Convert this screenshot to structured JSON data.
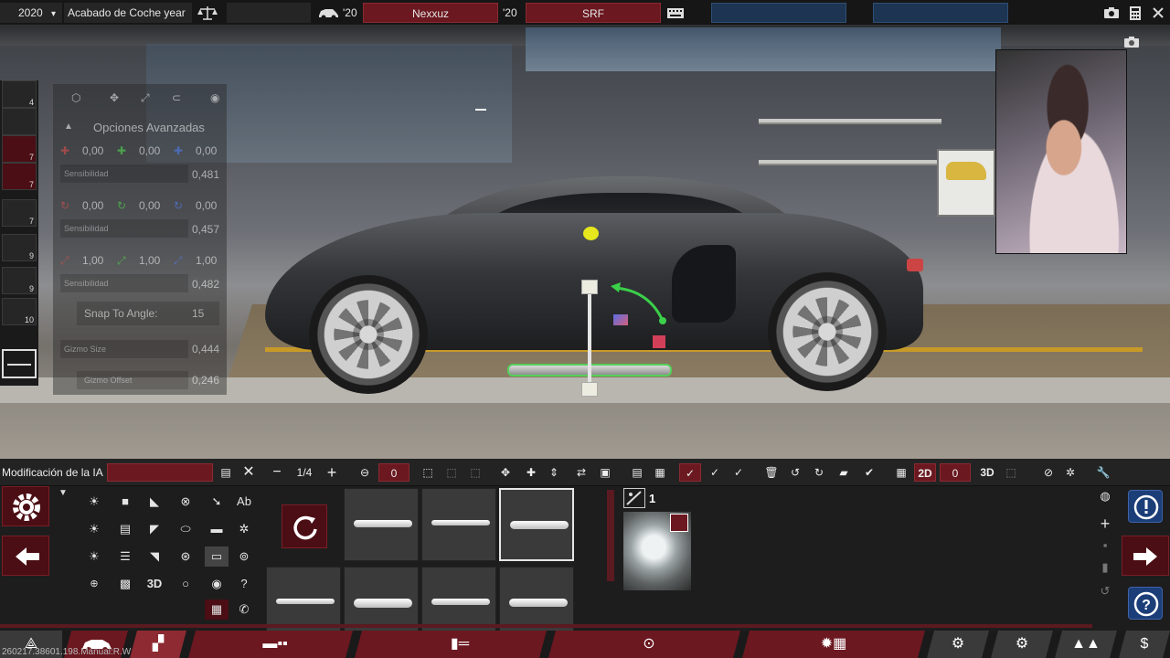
{
  "topbar": {
    "year": "2020",
    "year_chevron": "▾",
    "trim_name": "Acabado de Coche year",
    "trim_icon": "scale-icon",
    "car_year_left": "'20",
    "car_name": "Nexxuz",
    "car_year_right": "'20",
    "trim_code": "SRF",
    "icons": [
      "car-icon",
      "keyboard-icon",
      "camera-icon",
      "calculator-icon",
      "close-icon"
    ]
  },
  "advanced": {
    "title": "Opciones Avanzadas",
    "pos_x": "0,00",
    "pos_y": "0,00",
    "pos_z": "0,00",
    "pos_sens_label": "Sensibilidad",
    "pos_sens": "0,481",
    "rot_x": "0,00",
    "rot_y": "0,00",
    "rot_z": "0,00",
    "rot_sens_label": "Sensibilidad",
    "rot_sens": "0,457",
    "scl_x": "1,00",
    "scl_y": "1,00",
    "scl_z": "1,00",
    "scl_sens_label": "Sensibilidad",
    "scl_sens": "0,482",
    "snap_label": "Snap To Angle:",
    "snap_value": "15",
    "gizmo_size_label": "Gizmo Size",
    "gizmo_size": "0,444",
    "gizmo_offset_label": "Gizmo Offset",
    "gizmo_offset": "0,246"
  },
  "left_strip": {
    "counts": [
      "4",
      "7",
      "7",
      "7",
      "9",
      "9",
      "10"
    ]
  },
  "toolbar2": {
    "mode_label": "Modificación de la IA",
    "page": "1/4",
    "rotation_value": "0",
    "view_value": "0",
    "label_2d": "2D",
    "label_3d": "3D"
  },
  "tool_grid": {
    "ab_label": "Ab",
    "label_3d": "3D"
  },
  "material": {
    "count": "1"
  },
  "version_text": "260217.38601.198.Manual:R.W"
}
